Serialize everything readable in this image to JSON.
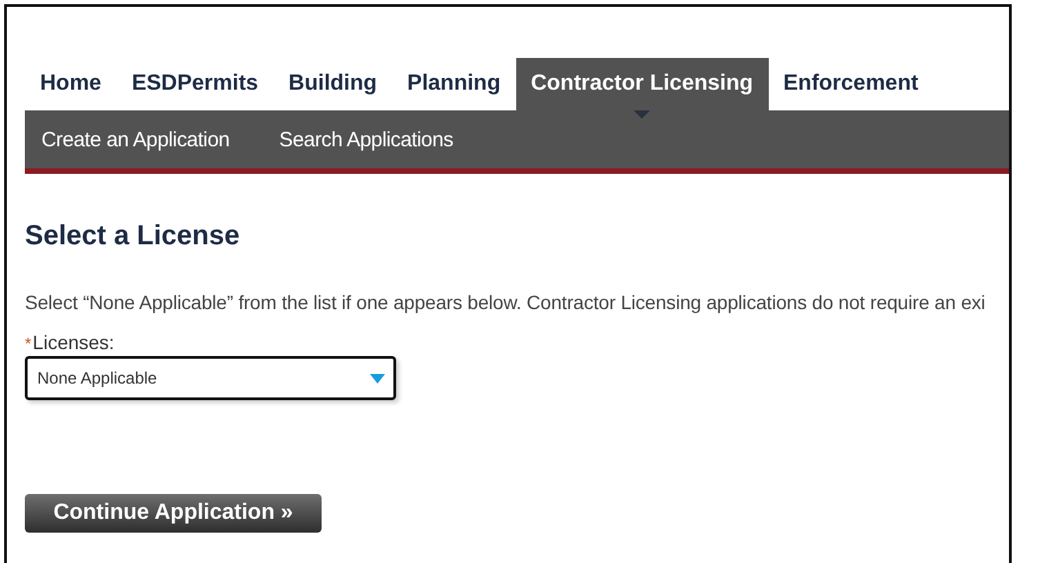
{
  "tabs": [
    {
      "label": "Home",
      "selected": false
    },
    {
      "label": "ESDPermits",
      "selected": false
    },
    {
      "label": "Building",
      "selected": false
    },
    {
      "label": "Planning",
      "selected": false
    },
    {
      "label": "Contractor Licensing",
      "selected": true
    },
    {
      "label": "Enforcement",
      "selected": false
    }
  ],
  "subnav": [
    "Create an Application",
    "Search Applications"
  ],
  "heading": "Select a License",
  "instructions": "Select “None Applicable” from the list if one appears below. Contractor Licensing applications do not require an exi",
  "licenses_field": {
    "required_mark": "*",
    "label": "Licenses:",
    "value": "None Applicable"
  },
  "continue_button": "Continue Application »"
}
